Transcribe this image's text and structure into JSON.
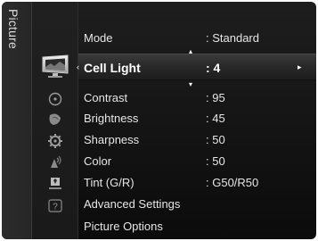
{
  "menu": {
    "category_label": "Picture",
    "rows": [
      {
        "label": "Mode",
        "value": ": Standard"
      },
      {
        "label": "Cell Light",
        "value": ": 4"
      },
      {
        "label": "Contrast",
        "value": ": 95"
      },
      {
        "label": "Brightness",
        "value": ": 45"
      },
      {
        "label": "Sharpness",
        "value": ": 50"
      },
      {
        "label": "Color",
        "value": ": 50"
      },
      {
        "label": "Tint (G/R)",
        "value": ": G50/R50"
      },
      {
        "label": "Advanced Settings",
        "value": ""
      },
      {
        "label": "Picture Options",
        "value": ""
      }
    ],
    "selected_row": "Cell Light",
    "nav_glyphs": {
      "left": "‹",
      "right": "▸",
      "up": "▴",
      "down": "▾"
    }
  },
  "icons": [
    "picture-icon",
    "input-icon",
    "sound-icon",
    "setup-icon",
    "channel-icon",
    "application-icon",
    "support-icon"
  ],
  "colors": {
    "background": "#151515",
    "text": "#e6e6e6",
    "highlight": "#3a3a3a"
  }
}
